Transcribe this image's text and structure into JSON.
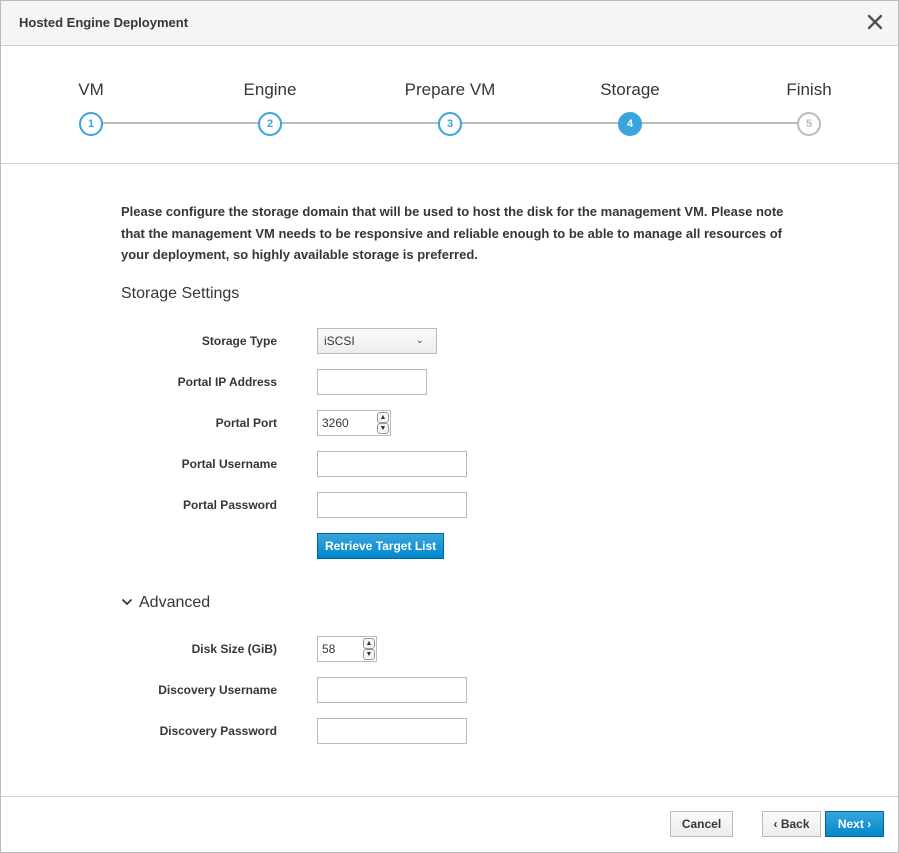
{
  "header": {
    "title": "Hosted Engine Deployment",
    "close_icon": "close-icon"
  },
  "steps": [
    {
      "number": "1",
      "label": "VM",
      "state": "complete"
    },
    {
      "number": "2",
      "label": "Engine",
      "state": "complete"
    },
    {
      "number": "3",
      "label": "Prepare VM",
      "state": "complete"
    },
    {
      "number": "4",
      "label": "Storage",
      "state": "active"
    },
    {
      "number": "5",
      "label": "Finish",
      "state": "future"
    }
  ],
  "main": {
    "intro": "Please configure the storage domain that will be used to host the disk for the management VM. Please note that the management VM needs to be responsive and reliable enough to be able to manage all resources of your deployment, so highly available storage is preferred.",
    "section_title": "Storage Settings",
    "storage_type": {
      "label": "Storage Type",
      "value": "iSCSI"
    },
    "portal_ip": {
      "label": "Portal IP Address",
      "value": ""
    },
    "portal_port": {
      "label": "Portal Port",
      "value": "3260"
    },
    "portal_username": {
      "label": "Portal Username",
      "value": ""
    },
    "portal_password": {
      "label": "Portal Password",
      "value": ""
    },
    "retrieve_button": "Retrieve Target List",
    "advanced": {
      "label": "Advanced",
      "expanded": true,
      "disk_size": {
        "label": "Disk Size (GiB)",
        "value": "58"
      },
      "discovery_username": {
        "label": "Discovery Username",
        "value": ""
      },
      "discovery_password": {
        "label": "Discovery Password",
        "value": ""
      }
    }
  },
  "footer": {
    "cancel": "Cancel",
    "back": "‹ Back",
    "next": "Next ›"
  },
  "colors": {
    "accent": "#39a5dc",
    "primary": "#0088ce",
    "border": "#bbbbbb",
    "header_bg": "#f5f5f5"
  }
}
